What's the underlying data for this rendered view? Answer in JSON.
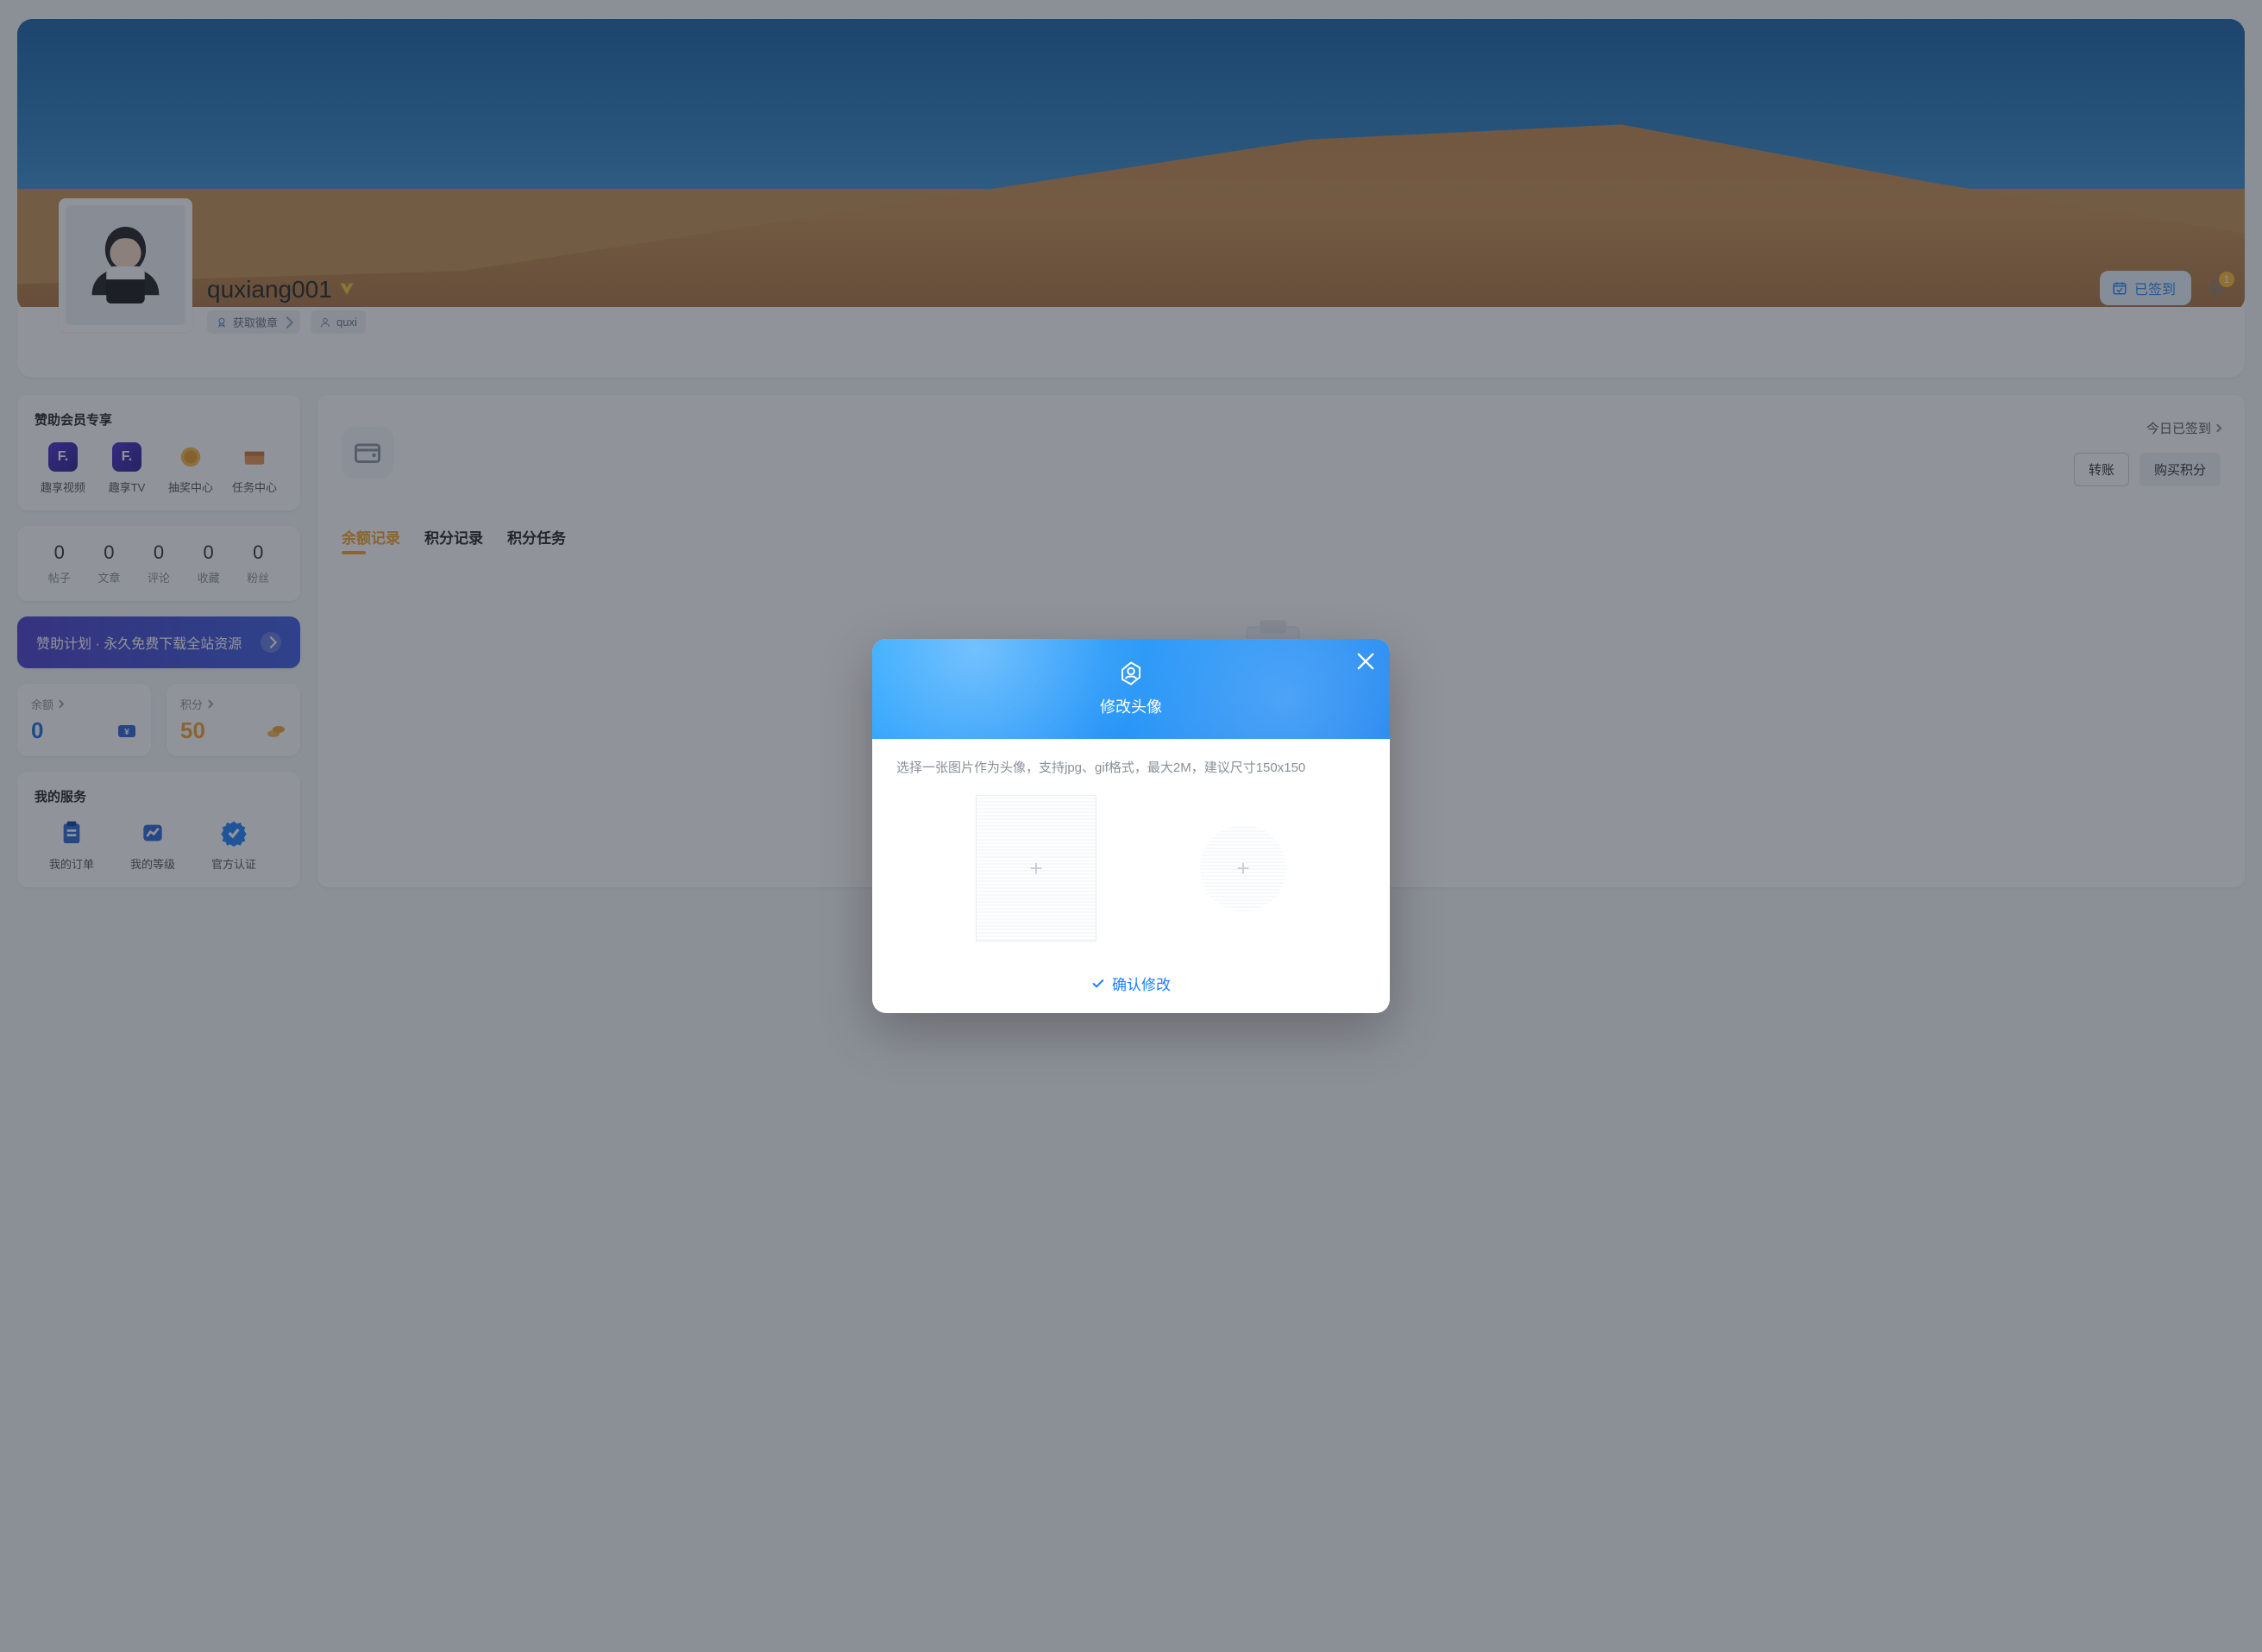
{
  "profile": {
    "username": "quxiang001",
    "badge_pill": "获取徽章",
    "user_pill_prefix": "quxi",
    "signed_button": "已签到",
    "bell_count": "1"
  },
  "sidebar": {
    "member_title": "赞助会员专享",
    "member_items": [
      "趣享视频",
      "趣享TV",
      "抽奖中心",
      "任务中心"
    ],
    "stats": [
      {
        "n": "0",
        "l": "帖子"
      },
      {
        "n": "0",
        "l": "文章"
      },
      {
        "n": "0",
        "l": "评论"
      },
      {
        "n": "0",
        "l": "收藏"
      },
      {
        "n": "0",
        "l": "粉丝"
      }
    ],
    "cta": "赞助计划 · 永久免费下载全站资源",
    "balance_label": "余额",
    "balance_value": "0",
    "points_label": "积分",
    "points_value": "50",
    "services_title": "我的服务",
    "services": [
      "我的订单",
      "我的等级",
      "官方认证"
    ]
  },
  "main": {
    "signed_today": "今日已签到",
    "transfer": "转账",
    "buy_points": "购买积分",
    "big_amount": "",
    "tabs": [
      "余额记录",
      "积分记录",
      "积分任务"
    ]
  },
  "modal": {
    "title": "修改头像",
    "hint": "选择一张图片作为头像，支持jpg、gif格式，最大2M，建议尺寸150x150",
    "confirm": "确认修改"
  }
}
